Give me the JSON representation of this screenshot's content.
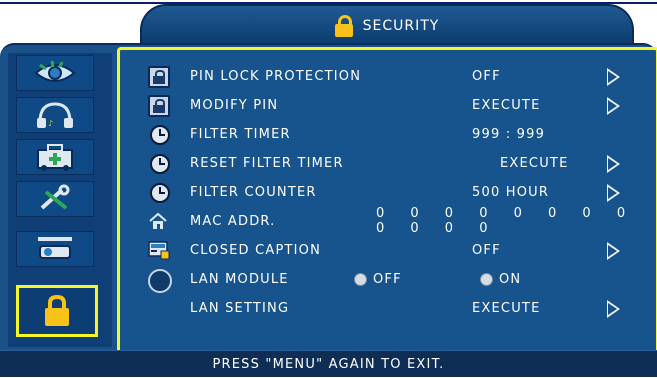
{
  "menu": {
    "title": "SECURITY",
    "footer_hint": "PRESS \"MENU\" AGAIN TO EXIT."
  },
  "sidebar": {
    "tabs": [
      {
        "icon": "eye-icon",
        "active": false
      },
      {
        "icon": "headphones-icon",
        "active": false
      },
      {
        "icon": "toolbox-icon",
        "active": false
      },
      {
        "icon": "wrench-icon",
        "active": false
      },
      {
        "icon": "projector-icon",
        "active": false
      },
      {
        "icon": "lock-icon",
        "active": true
      }
    ]
  },
  "settings": {
    "pin_lock": {
      "label": "PIN LOCK PROTECTION",
      "value": "OFF"
    },
    "modify_pin": {
      "label": "MODIFY PIN",
      "value": "EXECUTE"
    },
    "filter_timer": {
      "label": "FILTER TIMER",
      "value": "999 : 999"
    },
    "reset_filter_timer": {
      "label": "RESET FILTER TIMER",
      "value": "EXECUTE"
    },
    "filter_counter": {
      "label": "FILTER COUNTER",
      "value": "500 HOUR"
    },
    "mac_addr": {
      "label": "MAC ADDR.",
      "value": "0 0 0 0 0 0 0 0 0 0 0 0"
    },
    "closed_caption": {
      "label": "CLOSED CAPTION",
      "value": "OFF"
    },
    "lan_module": {
      "label": "LAN MODULE",
      "option_off": "OFF",
      "option_on": "ON"
    },
    "lan_setting": {
      "label": "LAN SETTING",
      "value": "EXECUTE"
    }
  },
  "colors": {
    "panel": "#1a5188",
    "highlight": "#f4f62a",
    "lock_accent": "#f8c21a"
  }
}
